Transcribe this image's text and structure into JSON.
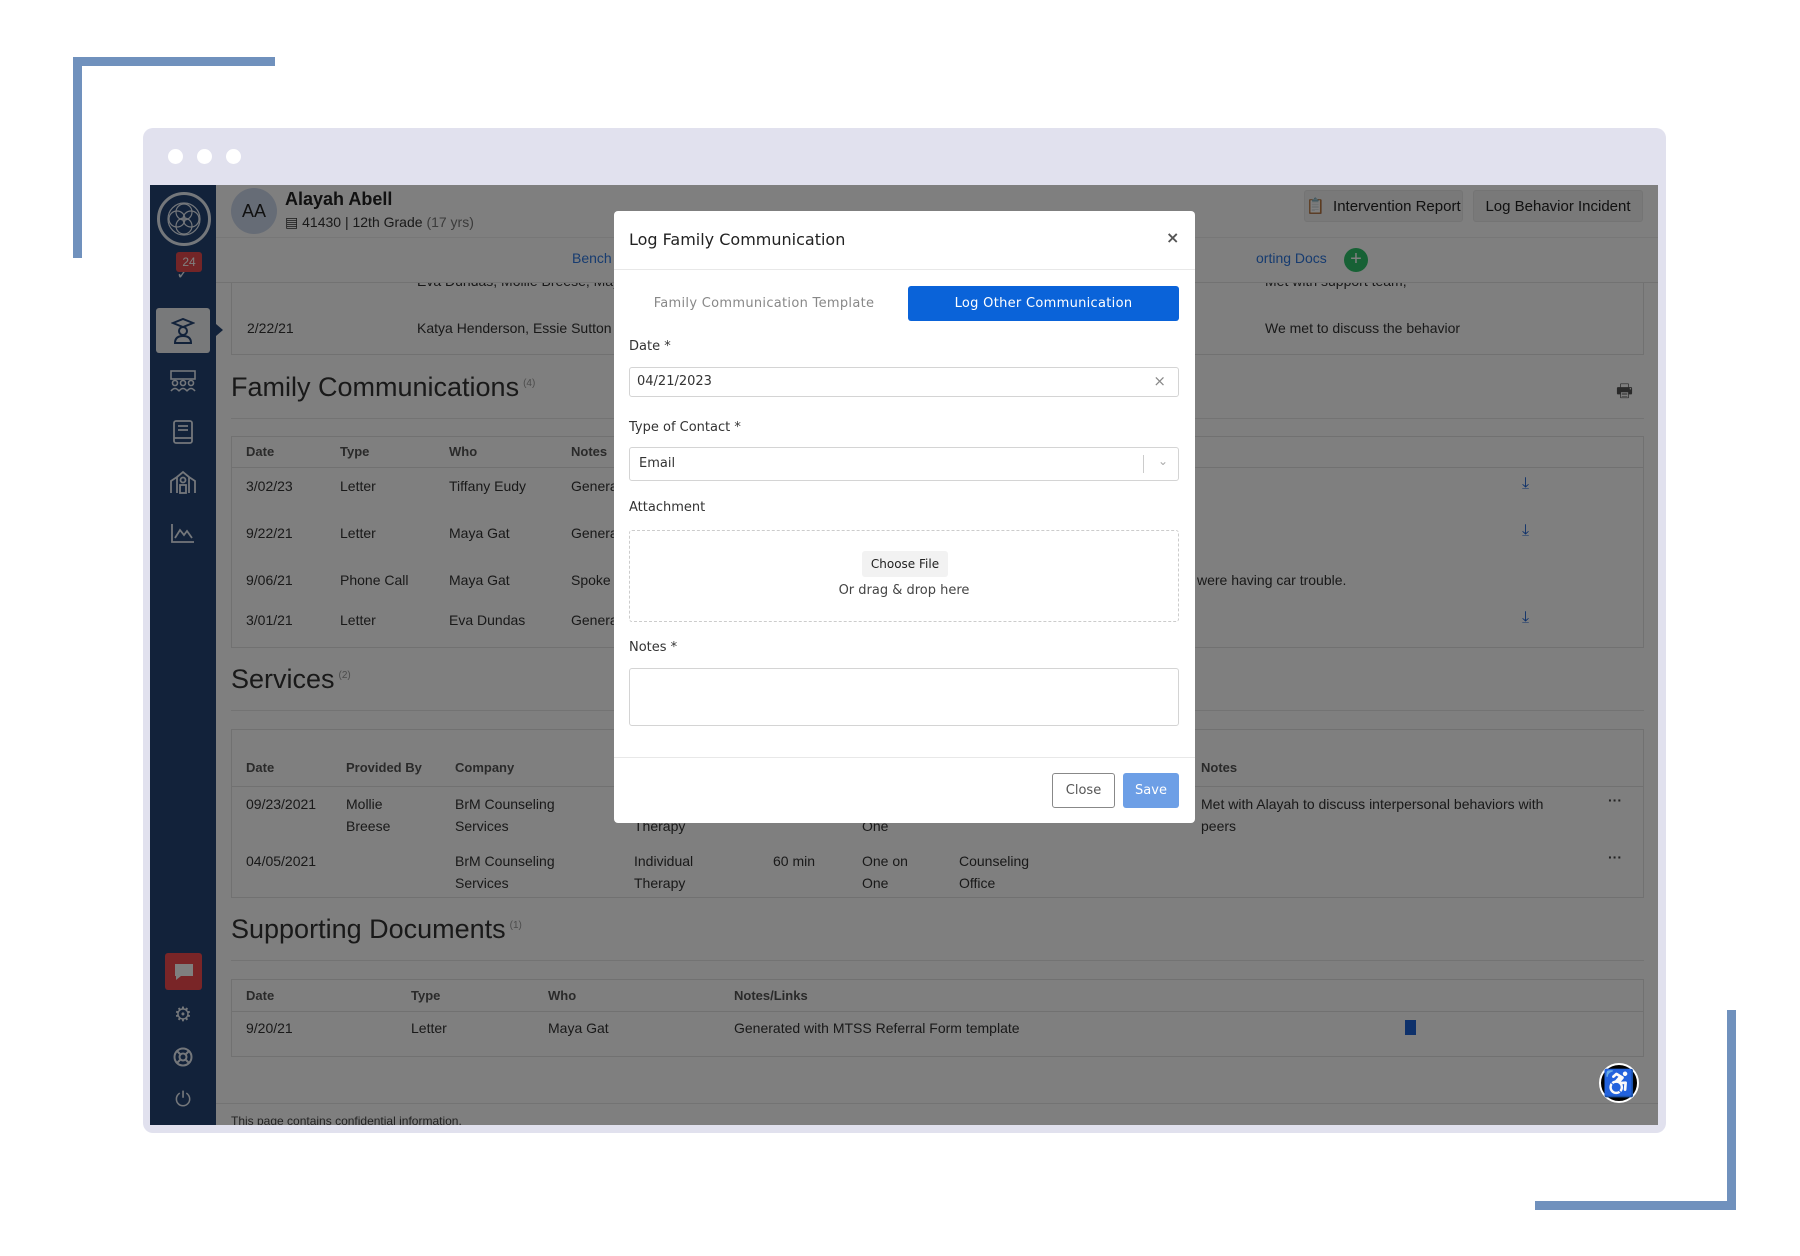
{
  "student": {
    "initials": "AA",
    "name": "Alayah Abell",
    "id": "41430",
    "grade": "12th Grade",
    "age": "(17 yrs)"
  },
  "header": {
    "intervention_report": "Intervention Report",
    "log_behavior": "Log Behavior Incident",
    "nav_partial_left": "Bench",
    "nav_partial_right": "orting Docs"
  },
  "sidebar": {
    "badge": "24"
  },
  "meetings": {
    "rows": [
      {
        "date": "",
        "who": "Eva Dundas, Mollie Breese, Maya G",
        "notes": "Met with support team,"
      },
      {
        "date": "2/22/21",
        "who": "Katya Henderson, Essie Sutton",
        "notes": "We met to discuss the behavior"
      }
    ]
  },
  "family": {
    "title": "Family Communications",
    "count": "(4)",
    "columns": [
      "Date",
      "Type",
      "Who",
      "Notes"
    ],
    "rows": [
      {
        "date": "3/02/23",
        "type": "Letter",
        "who": "Tiffany Eudy",
        "notes": "Genera",
        "notes_end": ""
      },
      {
        "date": "9/22/21",
        "type": "Letter",
        "who": "Maya Gat",
        "notes": "Genera",
        "notes_end": ""
      },
      {
        "date": "9/06/21",
        "type": "Phone Call",
        "who": "Maya Gat",
        "notes": "Spoke",
        "notes_end": "were having car trouble."
      },
      {
        "date": "3/01/21",
        "type": "Letter",
        "who": "Eva Dundas",
        "notes": "Genera",
        "notes_end": ""
      }
    ]
  },
  "services": {
    "title": "Services",
    "count": "(2)",
    "columns": [
      "Date",
      "Provided By",
      "Company",
      "Notes"
    ],
    "rows": [
      {
        "date": "09/23/2021",
        "by1": "Mollie",
        "by2": "Breese",
        "co1": "BrM Counseling",
        "co2": "Services",
        "type1": "",
        "type2": "Therapy",
        "dur": "",
        "fmt1": "",
        "fmt2": "One",
        "loc1": "",
        "loc2": "",
        "notes1": "Met with Alayah to discuss interpersonal behaviors with",
        "notes2": "peers"
      },
      {
        "date": "04/05/2021",
        "by1": "",
        "by2": "",
        "co1": "BrM Counseling",
        "co2": "Services",
        "type1": "Individual",
        "type2": "Therapy",
        "dur": "60 min",
        "fmt1": "One on",
        "fmt2": "One",
        "loc1": "Counseling",
        "loc2": "Office",
        "notes1": "",
        "notes2": ""
      }
    ]
  },
  "docs": {
    "title": "Supporting Documents",
    "count": "(1)",
    "columns": [
      "Date",
      "Type",
      "Who",
      "Notes/Links"
    ],
    "rows": [
      {
        "date": "9/20/21",
        "type": "Letter",
        "who": "Maya Gat",
        "notes": "Generated with MTSS Referral Form template"
      }
    ]
  },
  "footer": "This page contains confidential information.",
  "modal": {
    "title": "Log Family Communication",
    "tab_template": "Family Communication Template",
    "tab_other": "Log Other Communication",
    "date_label": "Date *",
    "date_value": "04/21/2023",
    "type_label": "Type of Contact *",
    "type_value": "Email",
    "attachment_label": "Attachment",
    "choose_file": "Choose File",
    "drag_drop": "Or drag & drop here",
    "notes_label": "Notes *",
    "notes_value": "",
    "close": "Close",
    "save": "Save"
  },
  "colors": {
    "accent": "#0a63d9",
    "save_disabled": "#6d9fe6",
    "sidebar": "#254574",
    "add_green": "#2ec26a"
  }
}
